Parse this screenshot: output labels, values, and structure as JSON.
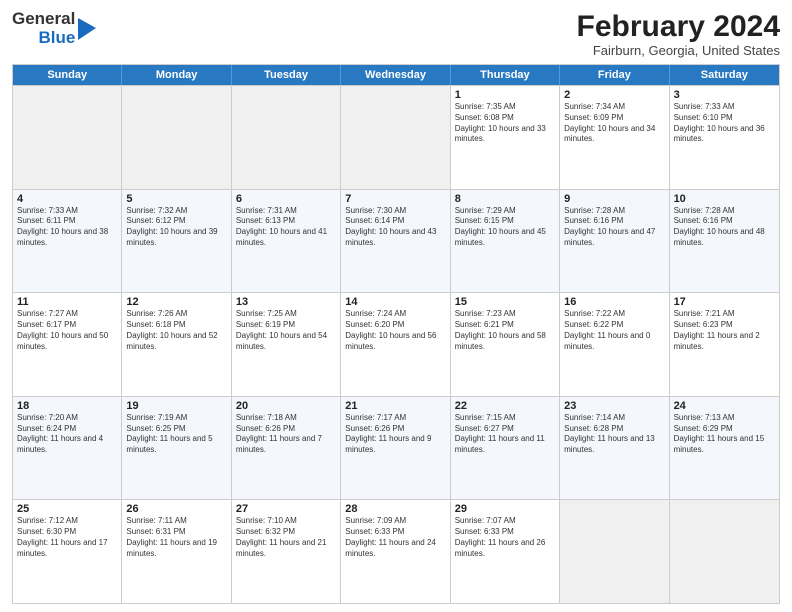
{
  "header": {
    "logo_line1": "General",
    "logo_line2": "Blue",
    "month": "February 2024",
    "location": "Fairburn, Georgia, United States"
  },
  "days": [
    "Sunday",
    "Monday",
    "Tuesday",
    "Wednesday",
    "Thursday",
    "Friday",
    "Saturday"
  ],
  "rows": [
    [
      {
        "day": "",
        "empty": true
      },
      {
        "day": "",
        "empty": true
      },
      {
        "day": "",
        "empty": true
      },
      {
        "day": "",
        "empty": true
      },
      {
        "day": "1",
        "sunrise": "7:35 AM",
        "sunset": "6:08 PM",
        "daylight": "10 hours and 33 minutes."
      },
      {
        "day": "2",
        "sunrise": "7:34 AM",
        "sunset": "6:09 PM",
        "daylight": "10 hours and 34 minutes."
      },
      {
        "day": "3",
        "sunrise": "7:33 AM",
        "sunset": "6:10 PM",
        "daylight": "10 hours and 36 minutes."
      }
    ],
    [
      {
        "day": "4",
        "sunrise": "7:33 AM",
        "sunset": "6:11 PM",
        "daylight": "10 hours and 38 minutes."
      },
      {
        "day": "5",
        "sunrise": "7:32 AM",
        "sunset": "6:12 PM",
        "daylight": "10 hours and 39 minutes."
      },
      {
        "day": "6",
        "sunrise": "7:31 AM",
        "sunset": "6:13 PM",
        "daylight": "10 hours and 41 minutes."
      },
      {
        "day": "7",
        "sunrise": "7:30 AM",
        "sunset": "6:14 PM",
        "daylight": "10 hours and 43 minutes."
      },
      {
        "day": "8",
        "sunrise": "7:29 AM",
        "sunset": "6:15 PM",
        "daylight": "10 hours and 45 minutes."
      },
      {
        "day": "9",
        "sunrise": "7:28 AM",
        "sunset": "6:16 PM",
        "daylight": "10 hours and 47 minutes."
      },
      {
        "day": "10",
        "sunrise": "7:28 AM",
        "sunset": "6:16 PM",
        "daylight": "10 hours and 48 minutes."
      }
    ],
    [
      {
        "day": "11",
        "sunrise": "7:27 AM",
        "sunset": "6:17 PM",
        "daylight": "10 hours and 50 minutes."
      },
      {
        "day": "12",
        "sunrise": "7:26 AM",
        "sunset": "6:18 PM",
        "daylight": "10 hours and 52 minutes."
      },
      {
        "day": "13",
        "sunrise": "7:25 AM",
        "sunset": "6:19 PM",
        "daylight": "10 hours and 54 minutes."
      },
      {
        "day": "14",
        "sunrise": "7:24 AM",
        "sunset": "6:20 PM",
        "daylight": "10 hours and 56 minutes."
      },
      {
        "day": "15",
        "sunrise": "7:23 AM",
        "sunset": "6:21 PM",
        "daylight": "10 hours and 58 minutes."
      },
      {
        "day": "16",
        "sunrise": "7:22 AM",
        "sunset": "6:22 PM",
        "daylight": "11 hours and 0 minutes."
      },
      {
        "day": "17",
        "sunrise": "7:21 AM",
        "sunset": "6:23 PM",
        "daylight": "11 hours and 2 minutes."
      }
    ],
    [
      {
        "day": "18",
        "sunrise": "7:20 AM",
        "sunset": "6:24 PM",
        "daylight": "11 hours and 4 minutes."
      },
      {
        "day": "19",
        "sunrise": "7:19 AM",
        "sunset": "6:25 PM",
        "daylight": "11 hours and 5 minutes."
      },
      {
        "day": "20",
        "sunrise": "7:18 AM",
        "sunset": "6:26 PM",
        "daylight": "11 hours and 7 minutes."
      },
      {
        "day": "21",
        "sunrise": "7:17 AM",
        "sunset": "6:26 PM",
        "daylight": "11 hours and 9 minutes."
      },
      {
        "day": "22",
        "sunrise": "7:15 AM",
        "sunset": "6:27 PM",
        "daylight": "11 hours and 11 minutes."
      },
      {
        "day": "23",
        "sunrise": "7:14 AM",
        "sunset": "6:28 PM",
        "daylight": "11 hours and 13 minutes."
      },
      {
        "day": "24",
        "sunrise": "7:13 AM",
        "sunset": "6:29 PM",
        "daylight": "11 hours and 15 minutes."
      }
    ],
    [
      {
        "day": "25",
        "sunrise": "7:12 AM",
        "sunset": "6:30 PM",
        "daylight": "11 hours and 17 minutes."
      },
      {
        "day": "26",
        "sunrise": "7:11 AM",
        "sunset": "6:31 PM",
        "daylight": "11 hours and 19 minutes."
      },
      {
        "day": "27",
        "sunrise": "7:10 AM",
        "sunset": "6:32 PM",
        "daylight": "11 hours and 21 minutes."
      },
      {
        "day": "28",
        "sunrise": "7:09 AM",
        "sunset": "6:33 PM",
        "daylight": "11 hours and 24 minutes."
      },
      {
        "day": "29",
        "sunrise": "7:07 AM",
        "sunset": "6:33 PM",
        "daylight": "11 hours and 26 minutes."
      },
      {
        "day": "",
        "empty": true
      },
      {
        "day": "",
        "empty": true
      }
    ]
  ]
}
